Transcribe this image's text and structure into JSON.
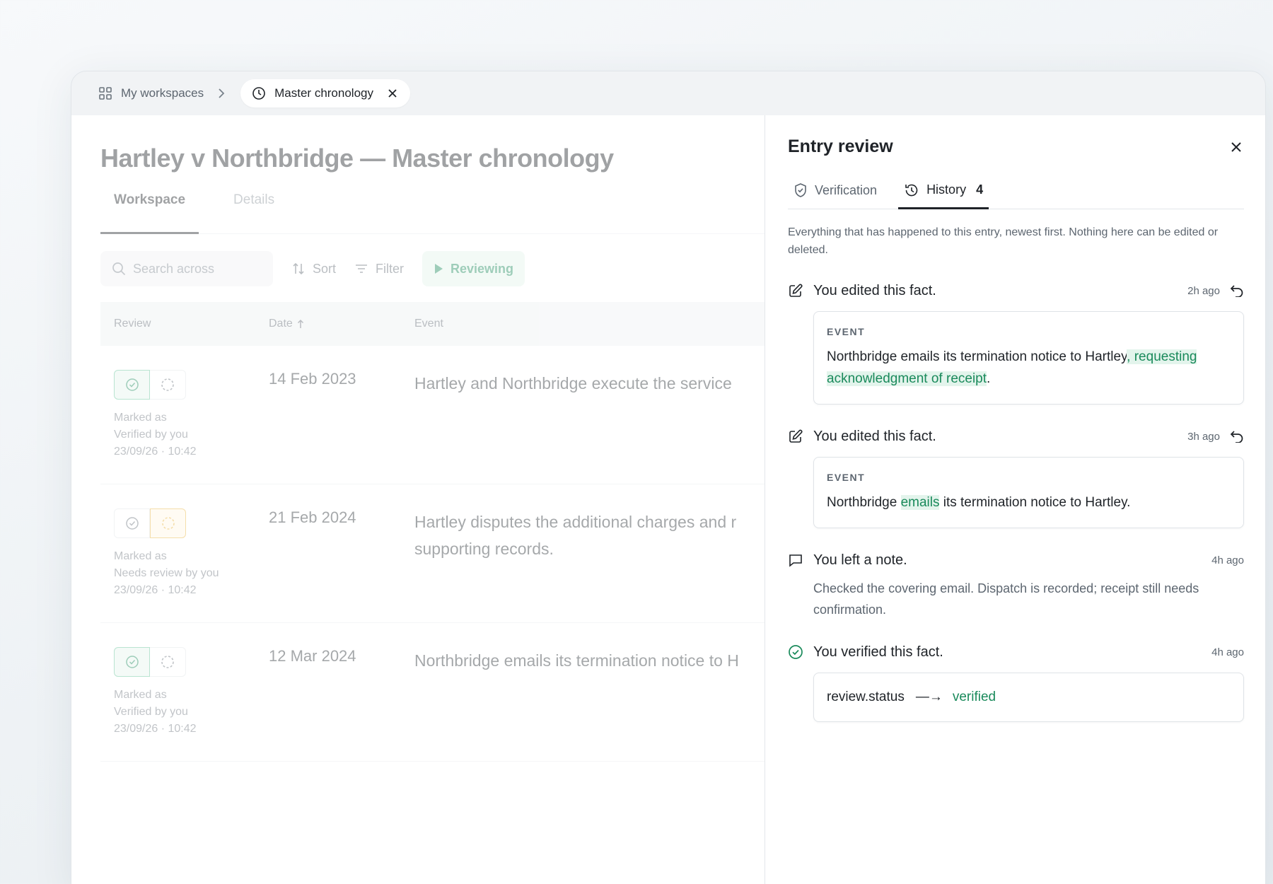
{
  "breadcrumb": {
    "root_label": "My workspaces",
    "active_tab_label": "Master chronology"
  },
  "main": {
    "title": "Hartley v Northbridge — Master chronology",
    "tabs": [
      {
        "label": "Workspace",
        "active": true
      },
      {
        "label": "Details",
        "active": false
      }
    ],
    "toolbar": {
      "search_placeholder": "Search across",
      "sort_label": "Sort",
      "filter_label": "Filter",
      "reviewing_label": "Reviewing"
    },
    "table": {
      "columns": [
        "Review",
        "Date",
        "Event"
      ],
      "rows": [
        {
          "review_state": "verified",
          "marked_line1": "Marked as",
          "marked_line2": "Verified by you",
          "marked_line3": "23/09/26 · 10:42",
          "date": "14 Feb 2023",
          "event": "Hartley and Northbridge execute the service"
        },
        {
          "review_state": "needs-review",
          "marked_line1": "Marked as",
          "marked_line2": "Needs review by you",
          "marked_line3": "23/09/26 · 10:42",
          "date": "21 Feb 2024",
          "event": "Hartley disputes the additional charges and r supporting records."
        },
        {
          "review_state": "verified",
          "marked_line1": "Marked as",
          "marked_line2": "Verified by you",
          "marked_line3": "23/09/26 · 10:42",
          "date": "12 Mar 2024",
          "event": "Northbridge emails its termination notice to H"
        }
      ]
    }
  },
  "panel": {
    "title": "Entry review",
    "tabs": [
      {
        "label": "Verification",
        "count": ""
      },
      {
        "label": "History",
        "count": "4"
      }
    ],
    "intro": "Everything that has happened to this entry, newest first. Nothing here can be edited or deleted.",
    "history": [
      {
        "type": "edit",
        "title": "You edited this fact.",
        "time": "2h ago",
        "card_label": "EVENT",
        "text_before": "Northbridge emails its termination notice to Hartley",
        "text_highlight": ", requesting acknowledgment of receipt",
        "text_after": "."
      },
      {
        "type": "edit",
        "title": "You edited this fact.",
        "time": "3h ago",
        "card_label": "EVENT",
        "text_before": "Northbridge ",
        "text_highlight": "emails",
        "text_after": " its termination notice to Hartley."
      },
      {
        "type": "note",
        "title": "You left a note.",
        "time": "4h ago",
        "note": "Checked the covering email. Dispatch is recorded; receipt still needs confirmation."
      },
      {
        "type": "verify",
        "title": "You verified this fact.",
        "time": "4h ago",
        "field": "review.status",
        "arrow": "—→",
        "value": "verified"
      }
    ]
  },
  "colors": {
    "accent_green": "#1a8a5b",
    "highlight_green_bg": "#e3f4ec",
    "amber": "#e8b23a",
    "text_primary": "#1f2328",
    "text_muted": "#5d6670"
  },
  "icons": {
    "workspaces": "grid-icon",
    "chronology": "clock-icon",
    "verification": "shield-check-icon",
    "history": "history-icon",
    "edit": "edit-icon",
    "note": "comment-icon",
    "verified": "check-circle-icon",
    "undo": "undo-icon"
  }
}
